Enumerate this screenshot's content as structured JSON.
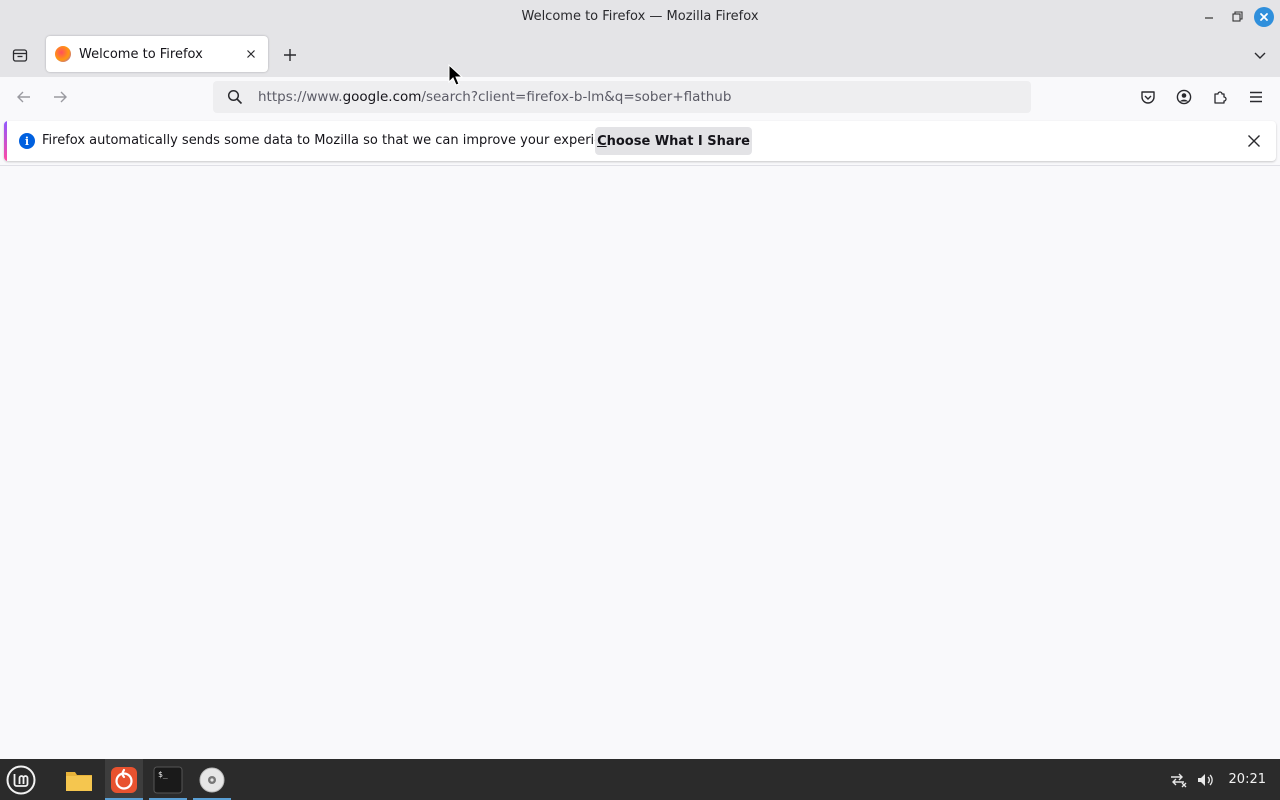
{
  "window": {
    "title": "Welcome to Firefox — Mozilla Firefox"
  },
  "tabs": [
    {
      "title": "Welcome to Firefox"
    }
  ],
  "urlbar": {
    "prefix": "https://www.",
    "domain": "google.com",
    "path": "/search?client=firefox-b-lm&q=sober+flathub"
  },
  "notification": {
    "message": "Firefox automatically sends some data to Mozilla so that we can improve your experience.",
    "button_accel": "C",
    "button_rest": "hoose What I Share"
  },
  "taskbar": {
    "clock": "20:21"
  },
  "colors": {
    "accent": "#0060df",
    "close": "#2f8fdc",
    "taskbar": "#2b2b2b"
  }
}
